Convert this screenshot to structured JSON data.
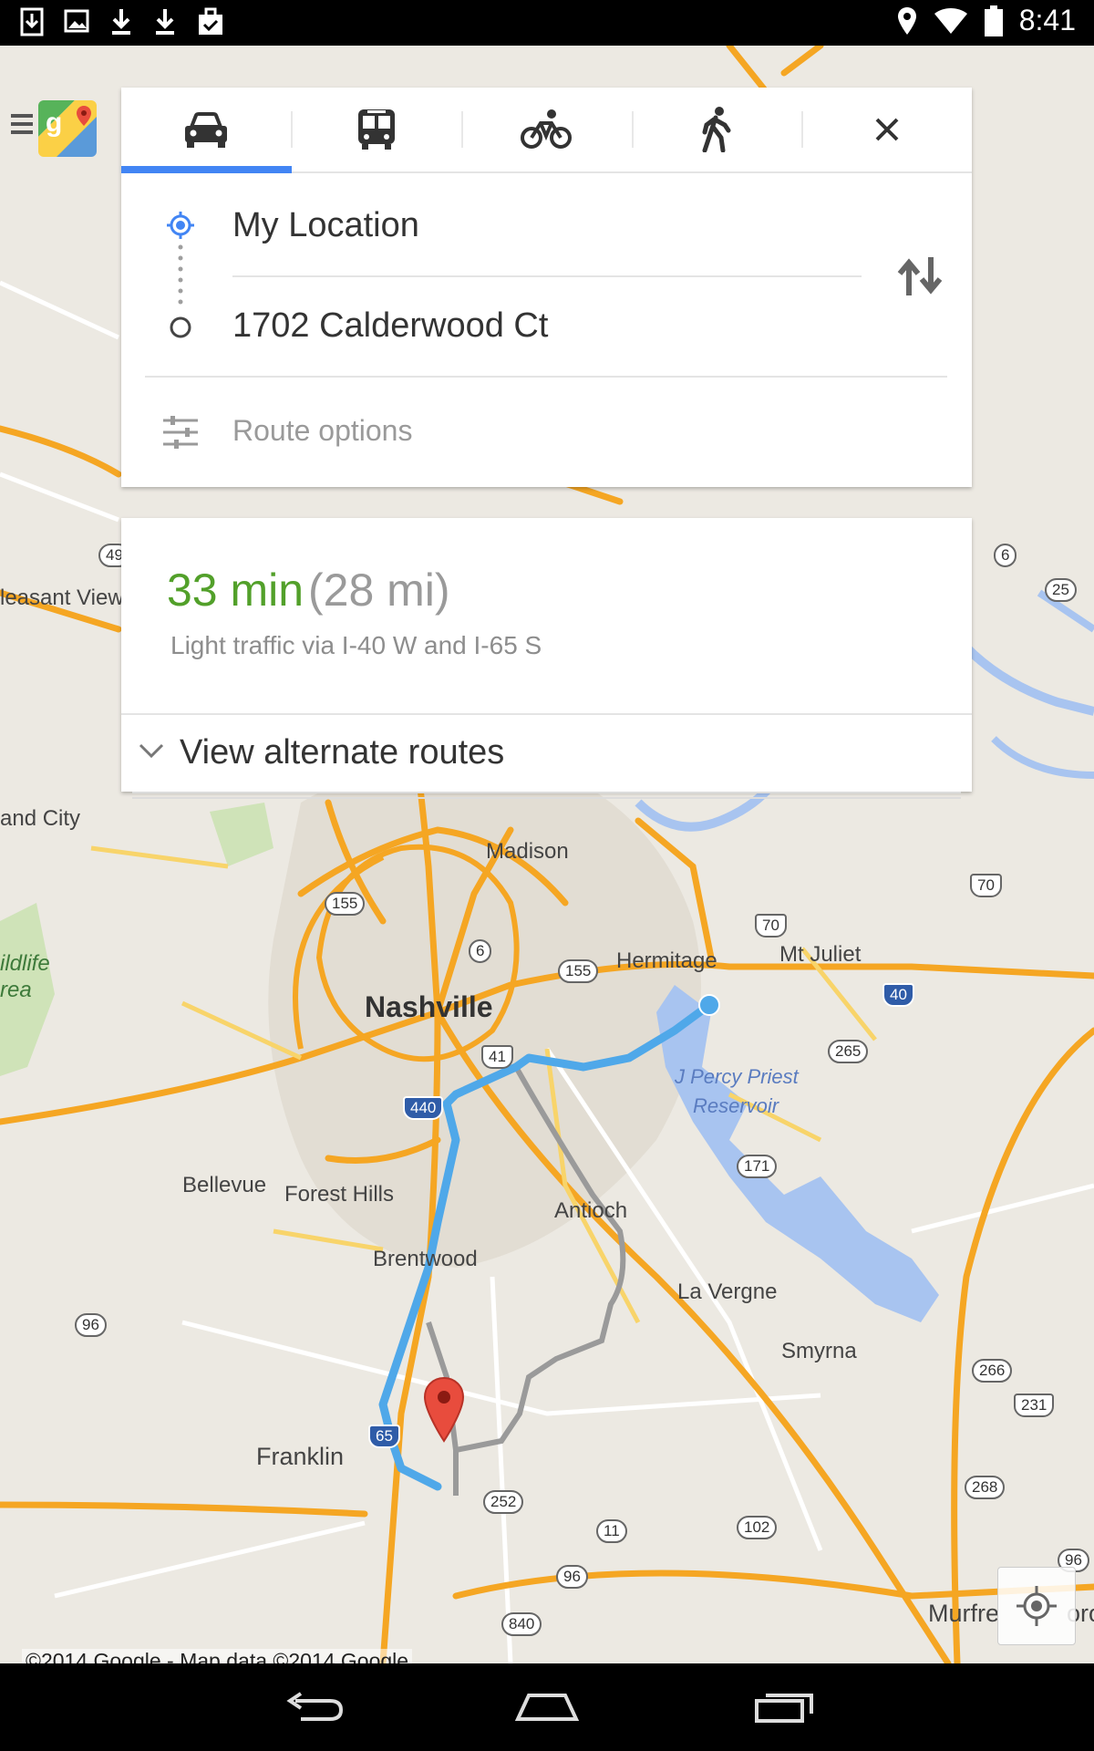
{
  "status_bar": {
    "time": "8:41",
    "left_icons": [
      "download-icon",
      "image-icon",
      "download-icon",
      "download-icon",
      "checkbag-icon"
    ],
    "right_icons": [
      "location-pin-icon",
      "wifi-icon",
      "battery-icon"
    ]
  },
  "travel_modes": [
    {
      "name": "car-icon",
      "selected": true
    },
    {
      "name": "transit-icon",
      "selected": false
    },
    {
      "name": "bike-icon",
      "selected": false
    },
    {
      "name": "walk-icon",
      "selected": false
    },
    {
      "name": "close-icon",
      "selected": false
    }
  ],
  "directions": {
    "origin": "My Location",
    "destination": "1702 Calderwood Ct",
    "route_options_label": "Route options"
  },
  "route": {
    "duration": "33 min",
    "distance": "(28 mi)",
    "via": "Light traffic via I-40 W and I-65 S",
    "alternate_label": "View alternate routes"
  },
  "map": {
    "places": {
      "nashville": "Nashville",
      "madison": "Madison",
      "hermitage": "Hermitage",
      "mt_juliet": "Mt Juliet",
      "bellevue": "Bellevue",
      "forest_hills": "Forest Hills",
      "antioch": "Antioch",
      "brentwood": "Brentwood",
      "la_vergne": "La Vergne",
      "smyrna": "Smyrna",
      "franklin": "Franklin",
      "pleasant_view": "leasant View",
      "land_city": "and City",
      "wildlife": "ildlife",
      "area": "rea",
      "murfreesboro": "Murfre",
      "murfreesboro_tail": "oro",
      "reservoir_1": "J Percy Priest",
      "reservoir_2": "Reservoir"
    },
    "shields": [
      "49",
      "6",
      "25",
      "155",
      "6",
      "70",
      "70",
      "155",
      "40",
      "265",
      "41",
      "440",
      "171",
      "96",
      "266",
      "231",
      "268",
      "65",
      "252",
      "102",
      "11",
      "96",
      "840",
      "96"
    ],
    "copyright": "©2014 Google - Map data ©2014 Google"
  },
  "colors": {
    "route_blue": "#4fa8e9",
    "alt_route_gray": "#9a9a9a",
    "highway_orange": "#f5a623",
    "water": "#a8c4f0",
    "accent_green": "#52a02a",
    "tab_indicator": "#4285f4"
  },
  "nav_bar": {
    "buttons": [
      "back-icon",
      "home-icon",
      "recents-icon"
    ]
  }
}
